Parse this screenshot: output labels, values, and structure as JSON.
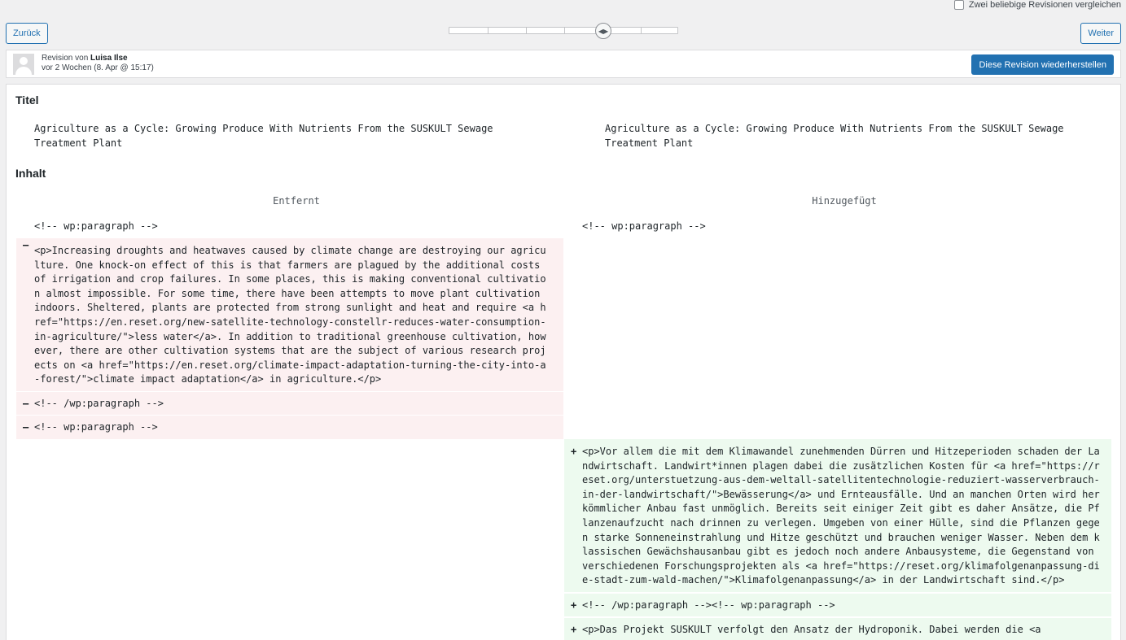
{
  "top": {
    "compare_label": "Zwei beliebige Revisionen vergleichen",
    "prev_label": "Zurück",
    "next_label": "Weiter",
    "slider_position_fraction": 0.67
  },
  "meta": {
    "revision_prefix": "Revision von",
    "author": "Luisa Ilse",
    "time": "vor 2 Wochen (8. Apr @ 15:17)",
    "restore_label": "Diese Revision wiederherstellen"
  },
  "content": {
    "title_heading": "Titel",
    "title_left": "Agriculture as a Cycle: Growing Produce With Nutrients From the SUSKULT Sewage Treatment Plant",
    "title_right": "Agriculture as a Cycle: Growing Produce With Nutrients From the SUSKULT Sewage Treatment Plant",
    "body_heading": "Inhalt",
    "removed_label": "Entfernt",
    "added_label": "Hinzugefügt",
    "context_left": "<!-- wp:paragraph -->",
    "context_right": "<!-- wp:paragraph -->",
    "removed_lines": [
      "<p>Increasing droughts and heatwaves caused by climate change are destroying our agriculture. One knock-on effect of this is that farmers are plagued by the additional costs of irrigation and crop failures. In some places, this is making conventional cultivation almost impossible. For some time, there have been attempts to move plant cultivation indoors. Sheltered, plants are protected from strong sunlight and heat and require <a href=\"https://en.reset.org/new-satellite-technology-constellr-reduces-water-consumption-in-agriculture/\">less water</a>. In addition to traditional greenhouse cultivation, however, there are other cultivation systems that are the subject of various research projects on <a href=\"https://en.reset.org/climate-impact-adaptation-turning-the-city-into-a-forest/\">climate impact adaptation</a> in agriculture.</p>",
      "<!-- /wp:paragraph -->",
      "<!-- wp:paragraph -->"
    ],
    "added_lines": [
      "<p>Vor allem die mit dem Klimawandel zunehmenden Dürren und Hitzeperioden schaden der Landwirtschaft. Landwirt*innen plagen dabei die zusätzlichen Kosten für <a href=\"https://reset.org/unterstuetzung-aus-dem-weltall-satellitentechnologie-reduziert-wasserverbrauch-in-der-landwirtschaft/\">Bewässerung</a> und Ernteausfälle. Und an manchen Orten wird herkömmlicher Anbau fast unmöglich. Bereits seit einiger Zeit gibt es daher Ansätze, die Pflanzenaufzucht nach drinnen zu verlegen. Umgeben von einer Hülle, sind die Pflanzen gegen starke Sonneneinstrahlung und Hitze geschützt und brauchen weniger Wasser. Neben dem klassischen Gewächshausanbau gibt es jedoch noch andere Anbausysteme, die Gegenstand von verschiedenen Forschungsprojekten als <a href=\"https://reset.org/klimafolgenanpassung-die-stadt-zum-wald-machen/\">Klimafolgenanpassung</a> in der Landwirtschaft sind.</p>",
      "<!-- /wp:paragraph --><!-- wp:paragraph -->",
      "<p>Das Projekt SUSKULT verfolgt den Ansatz der Hydroponik. Dabei werden die <a"
    ]
  }
}
